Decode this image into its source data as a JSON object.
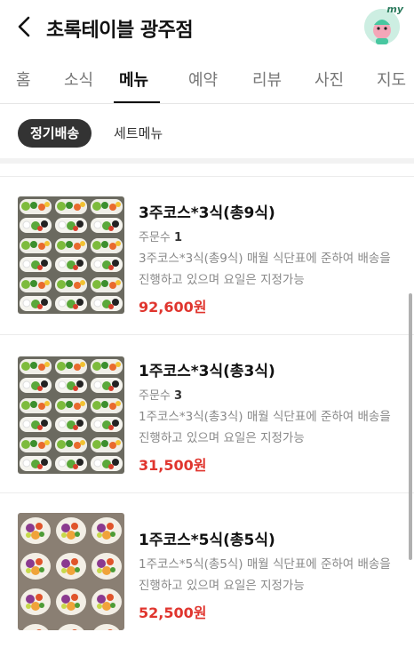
{
  "header": {
    "title": "초록테이블 광주점",
    "avatar_badge": "my"
  },
  "tabs": [
    "홈",
    "소식",
    "메뉴",
    "예약",
    "리뷰",
    "사진",
    "지도"
  ],
  "active_tab": "메뉴",
  "subtabs": {
    "active": "정기배송",
    "other": "세트메뉴"
  },
  "order_count_label": "주문수",
  "items": [
    {
      "name": "3주코스*3식(총9식)",
      "orders": "1",
      "desc": "3주코스*3식(총9식) 매월 식단표에 준하여 배송을 진행하고 있으며 요일은 지정가능",
      "price": "92,600원"
    },
    {
      "name": "1주코스*3식(총3식)",
      "orders": "3",
      "desc": "1주코스*3식(총3식) 매월 식단표에 준하여 배송을 진행하고 있으며 요일은 지정가능",
      "price": "31,500원"
    },
    {
      "name": "1주코스*5식(총5식)",
      "desc": "1주코스*5식(총5식) 매월 식단표에 준하여 배송을 진행하고 있으며 요일은 지정가능",
      "price": "52,500원"
    }
  ],
  "colors": {
    "price": "#e0352e",
    "chip_bg": "#333333"
  }
}
